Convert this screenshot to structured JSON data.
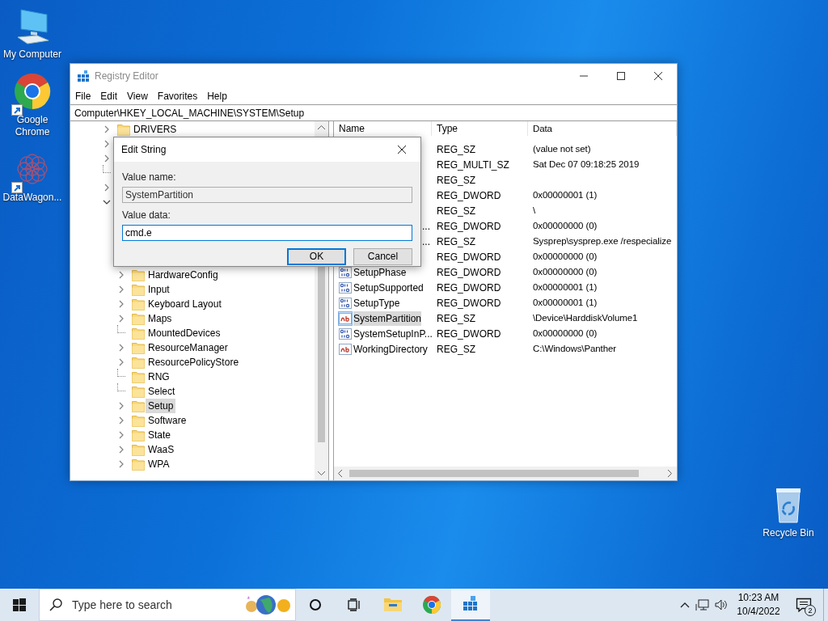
{
  "desktop_icons": [
    {
      "label": "My Computer",
      "kind": "computer",
      "shortcut": false
    },
    {
      "label": "Google Chrome",
      "kind": "browser",
      "shortcut": true
    },
    {
      "label": "DataWagon...",
      "kind": "pattern",
      "shortcut": true
    }
  ],
  "recycle_bin": {
    "label": "Recycle Bin"
  },
  "window": {
    "title": "Registry Editor",
    "active": false,
    "menu": [
      "File",
      "Edit",
      "View",
      "Favorites",
      "Help"
    ],
    "address": "Computer\\HKEY_LOCAL_MACHINE\\SYSTEM\\Setup",
    "tree": {
      "items": [
        {
          "label": "DRIVERS",
          "expandable": true,
          "expanded": false,
          "selected": false
        },
        {
          "expandable": true,
          "expanded": false,
          "selected": false
        },
        {
          "expandable": true,
          "expanded": false,
          "selected": false
        },
        {
          "expandable": false,
          "selected": false
        },
        {
          "expandable": true,
          "expanded": false,
          "selected": false
        },
        {
          "expandable": true,
          "expanded": true,
          "selected": false,
          "children": [
            {
              "label": "HardwareConfig",
              "expandable": true,
              "expanded": false,
              "selected": false
            },
            {
              "label": "Input",
              "expandable": true,
              "expanded": false,
              "selected": false
            },
            {
              "label": "Keyboard Layout",
              "expandable": true,
              "expanded": false,
              "selected": false
            },
            {
              "label": "Maps",
              "expandable": true,
              "expanded": false,
              "selected": false
            },
            {
              "label": "MountedDevices",
              "expandable": false,
              "selected": false
            },
            {
              "label": "ResourceManager",
              "expandable": true,
              "expanded": false,
              "selected": false
            },
            {
              "label": "ResourcePolicyStore",
              "expandable": true,
              "expanded": false,
              "selected": false
            },
            {
              "label": "RNG",
              "expandable": false,
              "selected": false
            },
            {
              "label": "Select",
              "expandable": false,
              "selected": false
            },
            {
              "label": "Setup",
              "expandable": true,
              "expanded": false,
              "selected": true
            },
            {
              "label": "Software",
              "expandable": true,
              "expanded": false,
              "selected": false
            },
            {
              "label": "State",
              "expandable": true,
              "expanded": false,
              "selected": false
            },
            {
              "label": "WaaS",
              "expandable": true,
              "expanded": false,
              "selected": false
            },
            {
              "label": "WPA",
              "expandable": true,
              "expanded": false,
              "selected": false
            }
          ]
        }
      ]
    },
    "values": {
      "columns": [
        "Name",
        "Type",
        "Data"
      ],
      "rows": [
        {
          "type": "REG_SZ",
          "data": "(value not set)",
          "selected": false
        },
        {
          "type": "REG_MULTI_SZ",
          "data": "Sat Dec 07 09:18:25 2019",
          "selected": false
        },
        {
          "type": "REG_SZ",
          "selected": false
        },
        {
          "type": "REG_DWORD",
          "data": "0x00000001 (1)",
          "selected": false
        },
        {
          "type": "REG_SZ",
          "data": "\\",
          "selected": false
        },
        {
          "name": "...",
          "type": "REG_DWORD",
          "data": "0x00000000 (0)",
          "selected": false
        },
        {
          "name": "...",
          "type": "REG_SZ",
          "data": "Sysprep\\sysprep.exe /respecialize",
          "selected": false
        },
        {
          "type": "REG_DWORD",
          "data": "0x00000000 (0)",
          "selected": false
        },
        {
          "kind": "binary",
          "name": "SetupPhase",
          "type": "REG_DWORD",
          "data": "0x00000000 (0)",
          "selected": false
        },
        {
          "kind": "binary",
          "name": "SetupSupported",
          "type": "REG_DWORD",
          "data": "0x00000001 (1)",
          "selected": false
        },
        {
          "kind": "binary",
          "name": "SetupType",
          "type": "REG_DWORD",
          "data": "0x00000001 (1)",
          "selected": false
        },
        {
          "kind": "string",
          "name": "SystemPartition",
          "type": "REG_SZ",
          "data": "\\Device\\HarddiskVolume1",
          "selected": true
        },
        {
          "kind": "binary",
          "name": "SystemSetupInP...",
          "type": "REG_DWORD",
          "data": "0x00000000 (0)",
          "selected": false
        },
        {
          "kind": "string",
          "name": "WorkingDirectory",
          "type": "REG_SZ",
          "data": "C:\\Windows\\Panther",
          "selected": false
        }
      ]
    }
  },
  "dialog": {
    "title": "Edit String",
    "fields": [
      {
        "label": "Value name:",
        "value": "SystemPartition",
        "disabled": true,
        "focused": false
      },
      {
        "label": "Value data:",
        "value": "cmd.e",
        "disabled": false,
        "focused": true
      }
    ],
    "buttons": [
      {
        "label": "OK",
        "default": true
      },
      {
        "label": "Cancel",
        "default": false
      }
    ]
  },
  "taskbar": {
    "search_placeholder": "Type here to search",
    "apps": [
      {
        "kind": "circle",
        "active": false
      },
      {
        "kind": "taskview",
        "active": false
      },
      {
        "kind": "folder",
        "active": false
      },
      {
        "kind": "browser",
        "active": false
      },
      {
        "kind": "cubes",
        "active": true
      }
    ],
    "time": "10:23 AM",
    "date": "10/4/2022",
    "notifications": "2"
  }
}
